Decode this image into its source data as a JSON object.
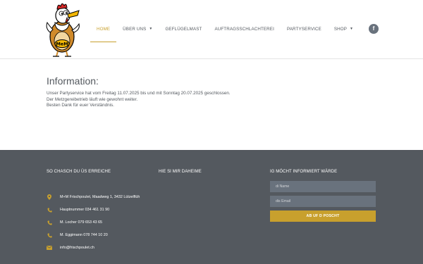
{
  "header": {
    "logo_alt": "MeM",
    "nav": [
      {
        "label": "HOME",
        "active": true,
        "dropdown": false
      },
      {
        "label": "ÜBER UNS",
        "active": false,
        "dropdown": true
      },
      {
        "label": "GEFLÜGELMAST",
        "active": false,
        "dropdown": false
      },
      {
        "label": "AUFTRAGSSCHLACHTEREI",
        "active": false,
        "dropdown": false
      },
      {
        "label": "PARTYSERVICE",
        "active": false,
        "dropdown": false
      },
      {
        "label": "SHOP",
        "active": false,
        "dropdown": true
      }
    ],
    "social_icon": "facebook-icon"
  },
  "main": {
    "title": "Information:",
    "lines": [
      "Unser Partyservice hat vom Freitag 11.07.2025 bis und mit Sonntag 20.07.2025 geschlossen.",
      "Der Metzgereibetrieb läuft wie gewohnt weiter.",
      "Besten Dank für euer Verständnis."
    ]
  },
  "footer": {
    "col1_title": "SO CHASCH DU ÜS ERREICHE",
    "col2_title": "HIE SI MIR DAHEIME",
    "col3_title": "IG MÖCHT INFORMIERT WÄRDE",
    "contacts": [
      {
        "icon": "map-marker-icon",
        "text": "M+M Frischpoulet, Maadweg 1, 3432 Lützelflüh"
      },
      {
        "icon": "phone-icon",
        "text": "Hauptnummer 034 461 31 90"
      },
      {
        "icon": "phone-icon",
        "text": "M. Locher 079 653 43 65"
      },
      {
        "icon": "phone-icon",
        "text": "M. Eggimann 078 744 10 20"
      },
      {
        "icon": "envelope-icon",
        "text": "info@frischpoulet.ch"
      }
    ],
    "name_placeholder": "di Name",
    "email_placeholder": "dis Email",
    "submit_label": "AB UF D POSCHT"
  },
  "colors": {
    "accent": "#c8a02d",
    "text": "#54595f",
    "footer_bg": "#54595f",
    "field_bg": "#69727d"
  }
}
